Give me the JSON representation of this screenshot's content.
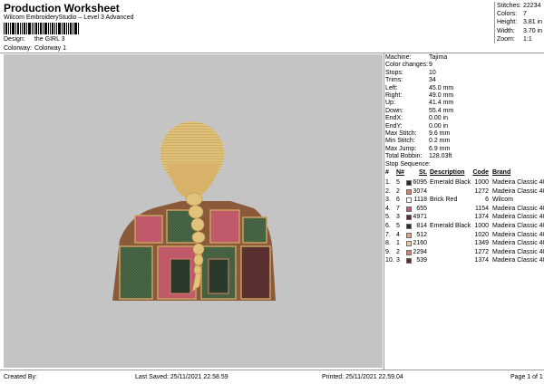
{
  "header": {
    "title": "Production Worksheet",
    "subtitle": "Wilcom EmbroideryStudio – Level 3 Advanced",
    "design_label": "Design:",
    "design_value": "the GIRL 3",
    "colorway_label": "Colorway:",
    "colorway_value": "Colorway 1"
  },
  "stats": [
    {
      "label": "Stitches:",
      "value": "22234"
    },
    {
      "label": "Colors:",
      "value": "7"
    },
    {
      "label": "Height:",
      "value": "3.81 in"
    },
    {
      "label": "Width:",
      "value": "3.70 in"
    },
    {
      "label": "Zoom:",
      "value": "1:1"
    }
  ],
  "machine_info": [
    {
      "label": "Machine:",
      "value": "Tajima"
    },
    {
      "label": "Color changes:",
      "value": "9"
    },
    {
      "label": "Stops:",
      "value": "10"
    },
    {
      "label": "Trims:",
      "value": "34"
    },
    {
      "label": "Left:",
      "value": "45.0 mm"
    },
    {
      "label": "Right:",
      "value": "49.0 mm"
    },
    {
      "label": "Up:",
      "value": "41.4 mm"
    },
    {
      "label": "Down:",
      "value": "55.4 mm"
    },
    {
      "label": "EndX:",
      "value": "0.00 in"
    },
    {
      "label": "EndY:",
      "value": "0.00 in"
    },
    {
      "label": "Max Stitch:",
      "value": "9.6 mm"
    },
    {
      "label": "Min Stitch:",
      "value": "0.2 mm"
    },
    {
      "label": "Max Jump:",
      "value": "6.9 mm"
    },
    {
      "label": "Total Bobbin:",
      "value": "128.03ft"
    }
  ],
  "stop_sequence": {
    "title": "Stop Sequence:",
    "headers": {
      "num": "#",
      "n": "N#",
      "st": "St.",
      "desc": "Description",
      "code": "Code",
      "brand": "Brand"
    },
    "rows": [
      {
        "num": "1.",
        "n": "5",
        "color": "#2a2a2a",
        "st": "6095",
        "desc": "Emerald Black",
        "code": "1000",
        "brand": "Madeira Classic 40"
      },
      {
        "num": "2.",
        "n": "2",
        "color": "#d9826a",
        "st": "3074",
        "desc": "",
        "code": "1272",
        "brand": "Madeira Classic 40"
      },
      {
        "num": "3.",
        "n": "6",
        "color": "#ffffff",
        "st": "1118",
        "desc": "Brick Red",
        "code": "6",
        "brand": "Wilcom"
      },
      {
        "num": "4.",
        "n": "7",
        "color": "#c85a6a",
        "st": "655",
        "desc": "",
        "code": "1154",
        "brand": "Madeira Classic 40"
      },
      {
        "num": "5.",
        "n": "3",
        "color": "#5a3030",
        "st": "4971",
        "desc": "",
        "code": "1374",
        "brand": "Madeira Classic 40"
      },
      {
        "num": "6.",
        "n": "5",
        "color": "#2a2a2a",
        "st": "814",
        "desc": "Emerald Black",
        "code": "1000",
        "brand": "Madeira Classic 40"
      },
      {
        "num": "7.",
        "n": "4",
        "color": "#e8a080",
        "st": "512",
        "desc": "",
        "code": "1020",
        "brand": "Madeira Classic 40"
      },
      {
        "num": "8.",
        "n": "1",
        "color": "#f0c8a0",
        "st": "2160",
        "desc": "",
        "code": "1349",
        "brand": "Madeira Classic 40"
      },
      {
        "num": "9.",
        "n": "2",
        "color": "#d9826a",
        "st": "2294",
        "desc": "",
        "code": "1272",
        "brand": "Madeira Classic 40"
      },
      {
        "num": "10.",
        "n": "3",
        "color": "#5a3030",
        "st": "539",
        "desc": "",
        "code": "1374",
        "brand": "Madeira Classic 40"
      }
    ]
  },
  "footer": {
    "created_by": "Created By:",
    "last_saved": "Last Saved: 25/11/2021 22.58.59",
    "printed": "Printed: 25/11/2021 22.59.04",
    "page": "Page 1 of 1"
  }
}
